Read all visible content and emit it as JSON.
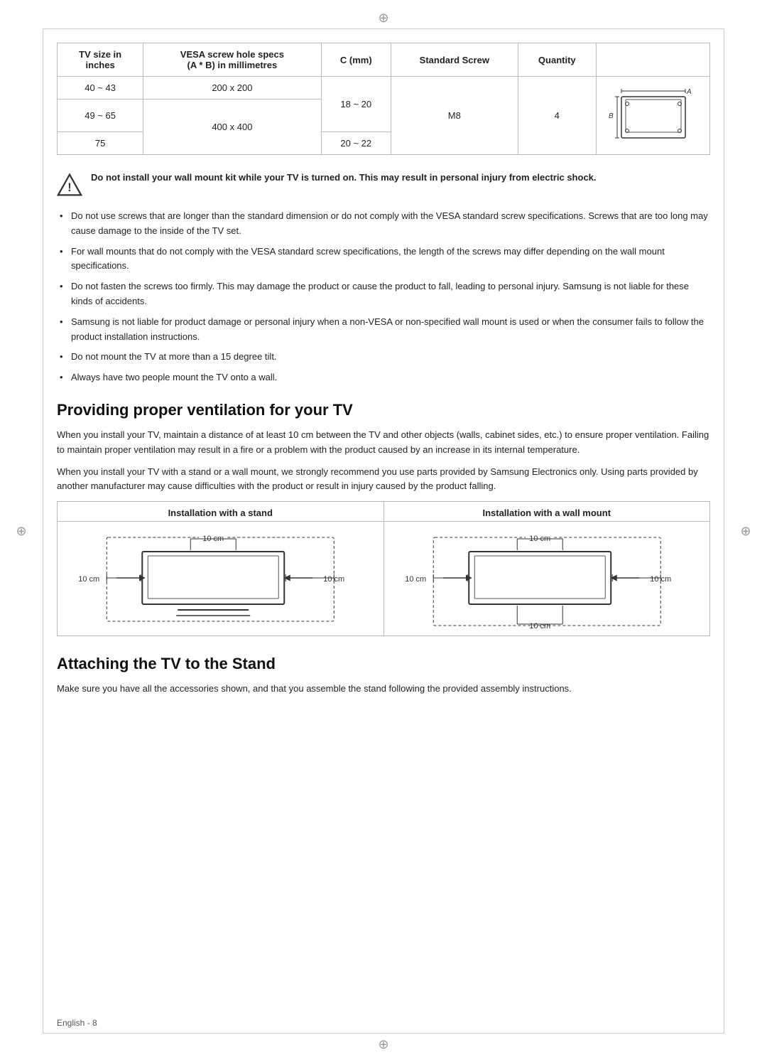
{
  "page": {
    "footer": "English - 8"
  },
  "table": {
    "headers": [
      "TV size in\ninches",
      "VESA screw hole specs\n(A * B) in millimetres",
      "C (mm)",
      "Standard Screw",
      "Quantity",
      "Diagram"
    ],
    "rows": [
      {
        "tv_size": "40 ~ 43",
        "vesa": "200 x 200",
        "c_mm": "18 ~ 20",
        "screw": "M8",
        "qty": "4"
      },
      {
        "tv_size": "49 ~ 65",
        "vesa": "400 x 400",
        "c_mm": "",
        "screw": "",
        "qty": ""
      },
      {
        "tv_size": "75",
        "vesa": "",
        "c_mm": "20 ~ 22",
        "screw": "",
        "qty": ""
      }
    ]
  },
  "warning": {
    "text": "Do not install your wall mount kit while your TV is turned on. This may result in personal injury from electric shock."
  },
  "bullets": [
    "Do not use screws that are longer than the standard dimension or do not comply with the VESA standard screw specifications. Screws that are too long may cause damage to the inside of the TV set.",
    "For wall mounts that do not comply with the VESA standard screw specifications, the length of the screws may differ depending on the wall mount specifications.",
    "Do not fasten the screws too firmly. This may damage the product or cause the product to fall, leading to personal injury. Samsung is not liable for these kinds of accidents.",
    "Samsung is not liable for product damage or personal injury when a non-VESA or non-specified wall mount is used or when the consumer fails to follow the product installation instructions.",
    "Do not mount the TV at more than a 15 degree tilt.",
    "Always have two people mount the TV onto a wall."
  ],
  "section1": {
    "heading": "Providing proper ventilation for your TV",
    "para1": "When you install your TV, maintain a distance of at least 10 cm between the TV and other objects (walls, cabinet sides, etc.) to ensure proper ventilation. Failing to maintain proper ventilation may result in a fire or a problem with the product caused by an increase in its internal temperature.",
    "para2": "When you install your TV with a stand or a wall mount, we strongly recommend you use parts provided by Samsung Electronics only. Using parts provided by another manufacturer may cause difficulties with the product or result in injury caused by the product falling.",
    "panel1_title": "Installation with a stand",
    "panel2_title": "Installation with a wall mount",
    "measurements": {
      "top": "10 cm",
      "left": "10 cm",
      "right": "10 cm",
      "bottom": "10 cm"
    }
  },
  "section2": {
    "heading": "Attaching the TV to the Stand",
    "para1": "Make sure you have all the accessories shown, and that you assemble the stand following the provided assembly instructions."
  }
}
